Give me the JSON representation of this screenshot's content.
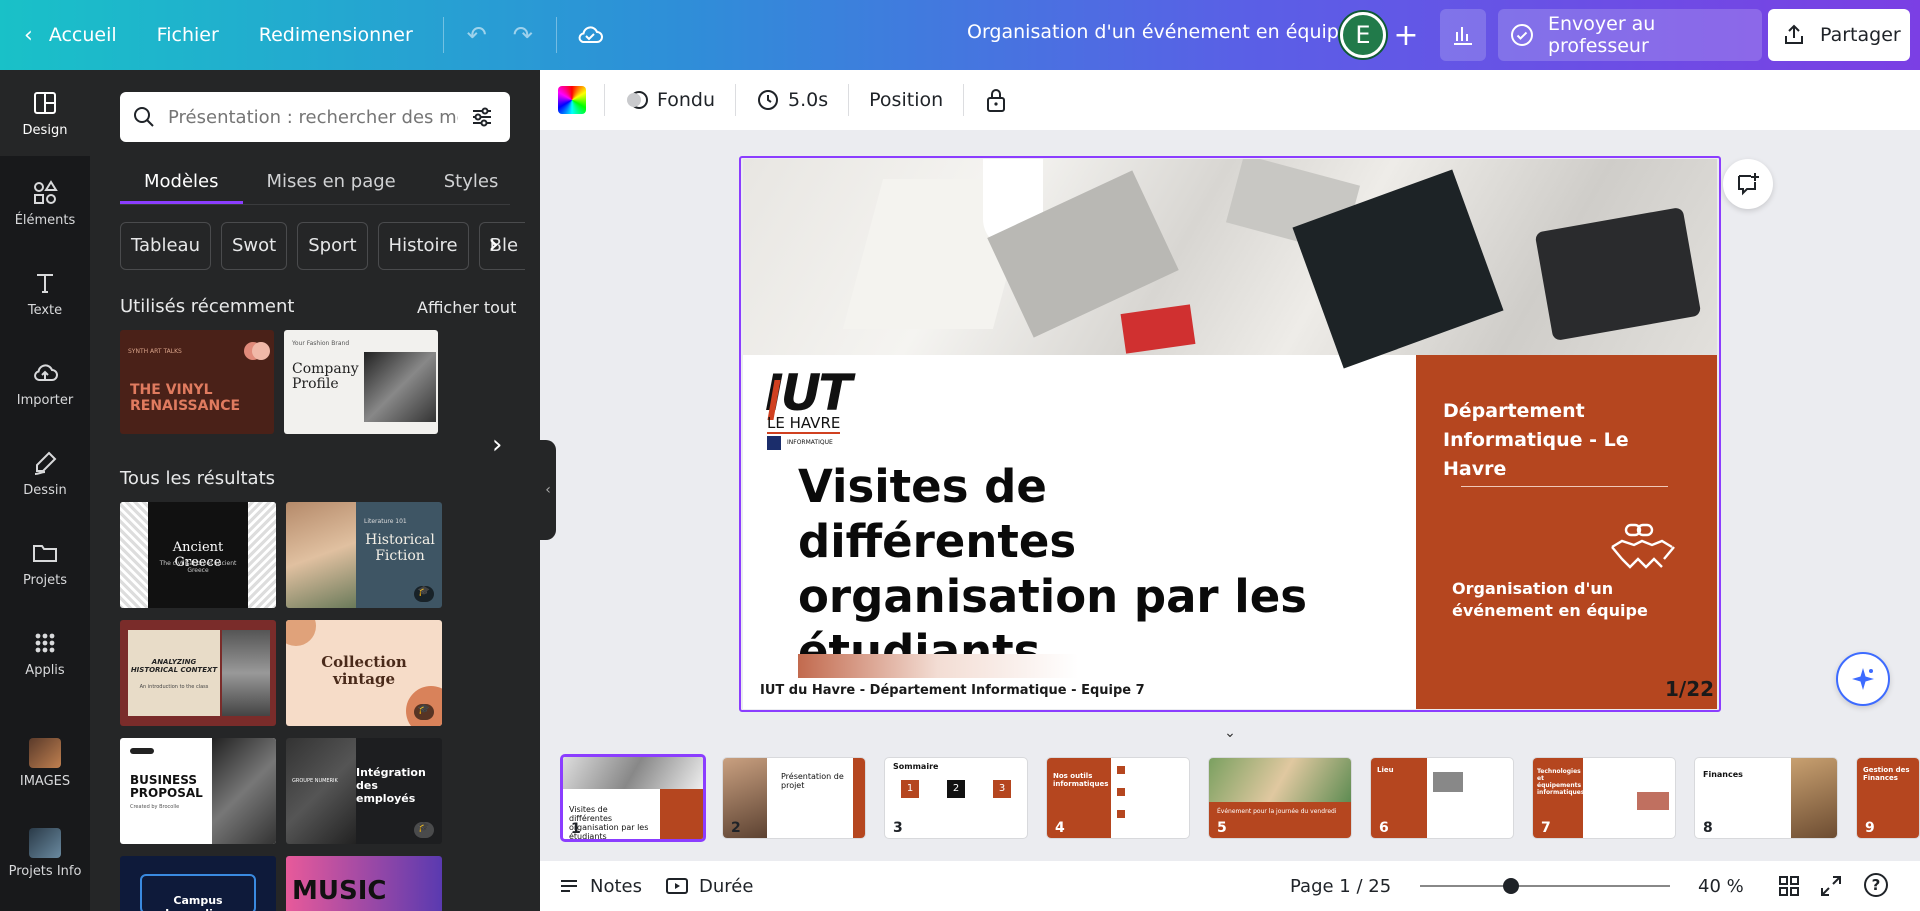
{
  "topbar": {
    "home_label": "Accueil",
    "file_label": "Fichier",
    "resize_label": "Redimensionner",
    "doc_title": "Organisation d'un événement en équipe",
    "avatar_initial": "E",
    "send_label": "Envoyer au professeur",
    "share_label": "Partager"
  },
  "rail": {
    "items": [
      {
        "label": "Design",
        "icon": "layout-icon"
      },
      {
        "label": "Éléments",
        "icon": "shapes-icon"
      },
      {
        "label": "Texte",
        "icon": "text-icon"
      },
      {
        "label": "Importer",
        "icon": "upload-cloud-icon"
      },
      {
        "label": "Dessin",
        "icon": "pen-icon"
      },
      {
        "label": "Projets",
        "icon": "folder-icon"
      },
      {
        "label": "Applis",
        "icon": "apps-grid-icon"
      },
      {
        "label": "IMAGES",
        "icon": "app-thumbnail"
      },
      {
        "label": "Projets Info",
        "icon": "app-thumbnail"
      }
    ]
  },
  "panel": {
    "search_placeholder": "Présentation : rechercher des mod",
    "tabs": [
      "Modèles",
      "Mises en page",
      "Styles"
    ],
    "chips": [
      "Tableau",
      "Swot",
      "Sport",
      "Histoire",
      "Ble"
    ],
    "recent_title": "Utilisés récemment",
    "recent_link": "Afficher tout",
    "recent": [
      {
        "title": "THE VINYL RENAISSANCE",
        "kicker": "SYNTH ART TALKS"
      },
      {
        "title": "Company Profile",
        "kicker": "Your Fashion Brand"
      }
    ],
    "all_title": "Tous les résultats",
    "results": [
      {
        "title": "Ancient Greece",
        "sub": "The civilisation of ancient Greece"
      },
      {
        "title": "Historical Fiction",
        "sub": "Literature 101"
      },
      {
        "title": "ANALYZING HISTORICAL CONTEXT",
        "sub": "An introduction to the class"
      },
      {
        "title": "Collection vintage",
        "sub": ""
      },
      {
        "title": "BUSINESS PROPOSAL",
        "sub": "Created by Brocolle"
      },
      {
        "title": "Intégration des employés",
        "sub": "GROUPE NUMERIK"
      },
      {
        "title": "Campus Journalism",
        "sub": ""
      },
      {
        "title": "MUSIC",
        "sub": ""
      }
    ]
  },
  "context_toolbar": {
    "transition": "Fondu",
    "duration": "5.0s",
    "position": "Position"
  },
  "slide": {
    "logo_main": "IUT",
    "logo_sub": "LE HAVRE",
    "logo_dept": "INFORMATIQUE",
    "title": "Visites de différentes organisation par les étudiants",
    "footer": "IUT du Havre - Département Informatique - Equipe 7",
    "right_heading": "Département Informatique - Le Havre",
    "right_subtitle": "Organisation d'un événement en équipe",
    "page_counter": "1/22",
    "accent_color": "#b5461f"
  },
  "filmstrip": [
    {
      "num": "1",
      "label": "Visites de différentes organisation par les étudiants"
    },
    {
      "num": "2",
      "label": "Présentation de projet"
    },
    {
      "num": "3",
      "label": "Sommaire"
    },
    {
      "num": "4",
      "label": "Nos outils informatiques"
    },
    {
      "num": "5",
      "label": "Événement pour la journée du vendredi"
    },
    {
      "num": "6",
      "label": "Lieu"
    },
    {
      "num": "7",
      "label": "Technologies et équipements informatiques"
    },
    {
      "num": "8",
      "label": "Finances"
    },
    {
      "num": "9",
      "label": "Gestion des Finances"
    }
  ],
  "bottombar": {
    "notes_label": "Notes",
    "duration_label": "Durée",
    "page_info": "Page 1 / 25",
    "zoom": "40 %"
  }
}
